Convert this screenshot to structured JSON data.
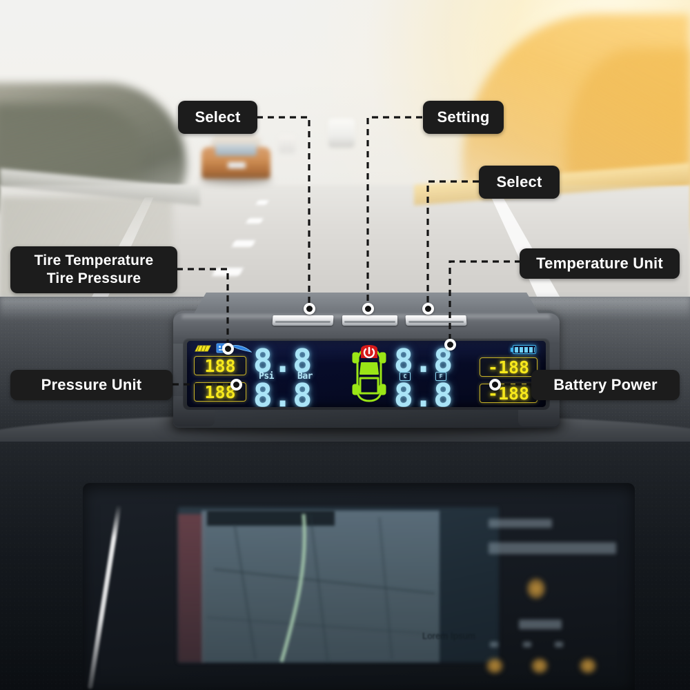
{
  "scene": {
    "description": "Highway driving view through windshield with TPMS solar tire pressure monitor on dashboard",
    "nav_screen_text": "Lorem Ipsum"
  },
  "annotations": [
    {
      "id": "select-left",
      "label": "Select",
      "target": "left-button"
    },
    {
      "id": "setting",
      "label": "Setting",
      "target": "middle-button"
    },
    {
      "id": "select-right",
      "label": "Select",
      "target": "right-button"
    },
    {
      "id": "tire-temp-pressure",
      "label_line1": "Tire Temperature",
      "label_line2": "Tire Pressure",
      "target": "lcd-left-readouts"
    },
    {
      "id": "temperature-unit",
      "label": "Temperature Unit",
      "target": "lcd-temp-unit"
    },
    {
      "id": "pressure-unit",
      "label": "Pressure Unit",
      "target": "lcd-pressure-unit"
    },
    {
      "id": "battery-power",
      "label": "Battery Power",
      "target": "lcd-battery"
    }
  ],
  "device": {
    "buttons": [
      {
        "name": "left-button",
        "label": ""
      },
      {
        "name": "middle-button",
        "label": ""
      },
      {
        "name": "right-button",
        "label": ""
      }
    ],
    "lcd": {
      "unit_labels": {
        "psi": "Psi",
        "bar": "Bar"
      },
      "front_left": {
        "pressure": "8.8",
        "temperature": "188"
      },
      "rear_left": {
        "pressure": "8.8",
        "temperature": "188"
      },
      "front_right": {
        "pressure": "8.8",
        "temperature": "-188"
      },
      "rear_right": {
        "pressure": "8.8",
        "temperature": "-188"
      },
      "temp_unit_markers": [
        "C",
        "F"
      ],
      "battery": {
        "icon": "battery-icon",
        "level": "full"
      },
      "car_icon": {
        "name": "car-top-view-icon",
        "warning": "tpms-warning-icon"
      },
      "status_icons": [
        "solar-panel-icon",
        "usb-icon",
        "signal-icon"
      ]
    }
  },
  "colors": {
    "pill_bg": "#1c1c1c",
    "pill_text": "#ffffff",
    "lcd_bg": "#070c2a",
    "lcd_cyan": "#a9e4f7",
    "lcd_yellow": "#f6e81c",
    "lcd_green": "#9ae616",
    "lcd_red": "#d61a1a",
    "lcd_blue": "#3fb6ee"
  }
}
